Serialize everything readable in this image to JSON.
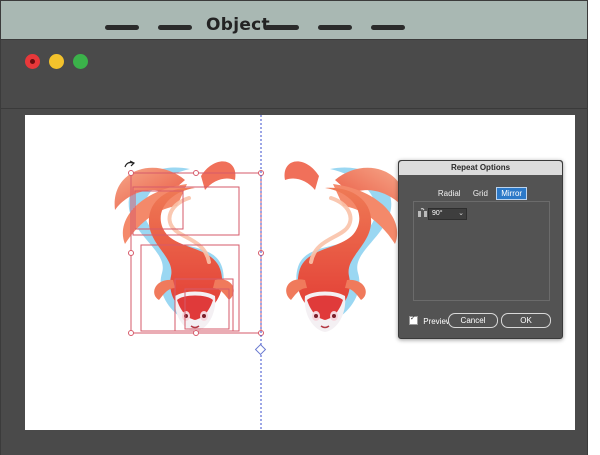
{
  "menubar": {
    "title": "Object"
  },
  "dialog": {
    "title": "Repeat Options",
    "tabs": [
      {
        "label": "Radial",
        "active": false
      },
      {
        "label": "Grid",
        "active": false
      },
      {
        "label": "Mirror",
        "active": true
      }
    ],
    "angle": {
      "value": "90°"
    },
    "preview_label": "Preview",
    "preview_checked": true,
    "cancel_label": "Cancel",
    "ok_label": "OK"
  },
  "colors": {
    "accent": "#2c79c8",
    "fish_red": "#e64a40",
    "fish_orange": "#f28a5c",
    "selection": "#d65a6a",
    "mirror_axis": "#3a4ccc"
  }
}
